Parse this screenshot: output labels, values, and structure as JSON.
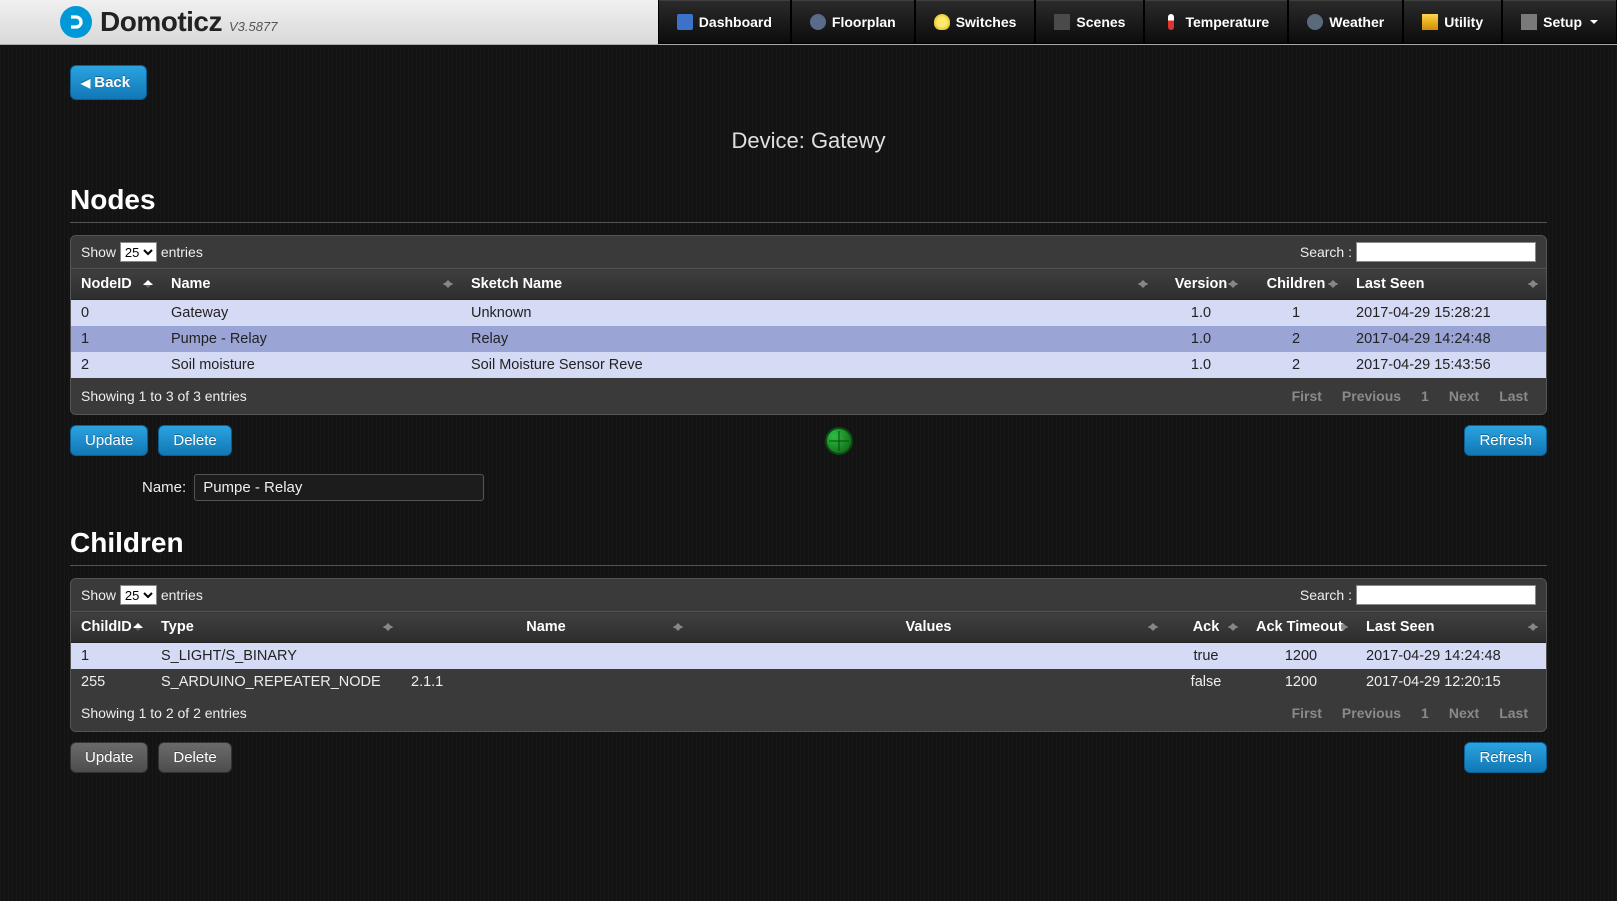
{
  "brand": {
    "name": "Domoticz",
    "version": "V3.5877"
  },
  "nav": {
    "dashboard": "Dashboard",
    "floorplan": "Floorplan",
    "switches": "Switches",
    "scenes": "Scenes",
    "temperature": "Temperature",
    "weather": "Weather",
    "utility": "Utility",
    "setup": "Setup"
  },
  "back_label": "Back",
  "page_title": "Device: Gatewy",
  "nodes": {
    "heading": "Nodes",
    "show_label": "Show",
    "entries_label": "entries",
    "entries_value": "25",
    "search_label": "Search :",
    "columns": {
      "node_id": "NodeID",
      "name": "Name",
      "sketch": "Sketch Name",
      "version": "Version",
      "children": "Children",
      "last_seen": "Last Seen"
    },
    "rows": [
      {
        "id": "0",
        "name": "Gateway",
        "sketch": "Unknown",
        "version": "1.0",
        "children": "1",
        "last_seen": "2017-04-29 15:28:21"
      },
      {
        "id": "1",
        "name": "Pumpe - Relay",
        "sketch": "Relay",
        "version": "1.0",
        "children": "2",
        "last_seen": "2017-04-29 14:24:48"
      },
      {
        "id": "2",
        "name": "Soil moisture",
        "sketch": "Soil Moisture Sensor Reve",
        "version": "1.0",
        "children": "2",
        "last_seen": "2017-04-29 15:43:56"
      }
    ],
    "info": "Showing 1 to 3 of 3 entries",
    "pager": {
      "first": "First",
      "prev": "Previous",
      "page": "1",
      "next": "Next",
      "last": "Last"
    },
    "update": "Update",
    "delete": "Delete",
    "refresh": "Refresh",
    "name_label": "Name:",
    "name_value": "Pumpe - Relay"
  },
  "children": {
    "heading": "Children",
    "show_label": "Show",
    "entries_label": "entries",
    "entries_value": "25",
    "search_label": "Search :",
    "columns": {
      "child_id": "ChildID",
      "type": "Type",
      "name": "Name",
      "values": "Values",
      "ack": "Ack",
      "ack_timeout": "Ack Timeout",
      "last_seen": "Last Seen"
    },
    "rows": [
      {
        "id": "1",
        "type": "S_LIGHT/S_BINARY",
        "name": "",
        "values": "",
        "ack": "true",
        "ack_timeout": "1200",
        "last_seen": "2017-04-29 14:24:48"
      },
      {
        "id": "255",
        "type": "S_ARDUINO_REPEATER_NODE",
        "name": "2.1.1",
        "values": "",
        "ack": "false",
        "ack_timeout": "1200",
        "last_seen": "2017-04-29 12:20:15"
      }
    ],
    "info": "Showing 1 to 2 of 2 entries",
    "pager": {
      "first": "First",
      "prev": "Previous",
      "page": "1",
      "next": "Next",
      "last": "Last"
    },
    "update": "Update",
    "delete": "Delete",
    "refresh": "Refresh"
  }
}
